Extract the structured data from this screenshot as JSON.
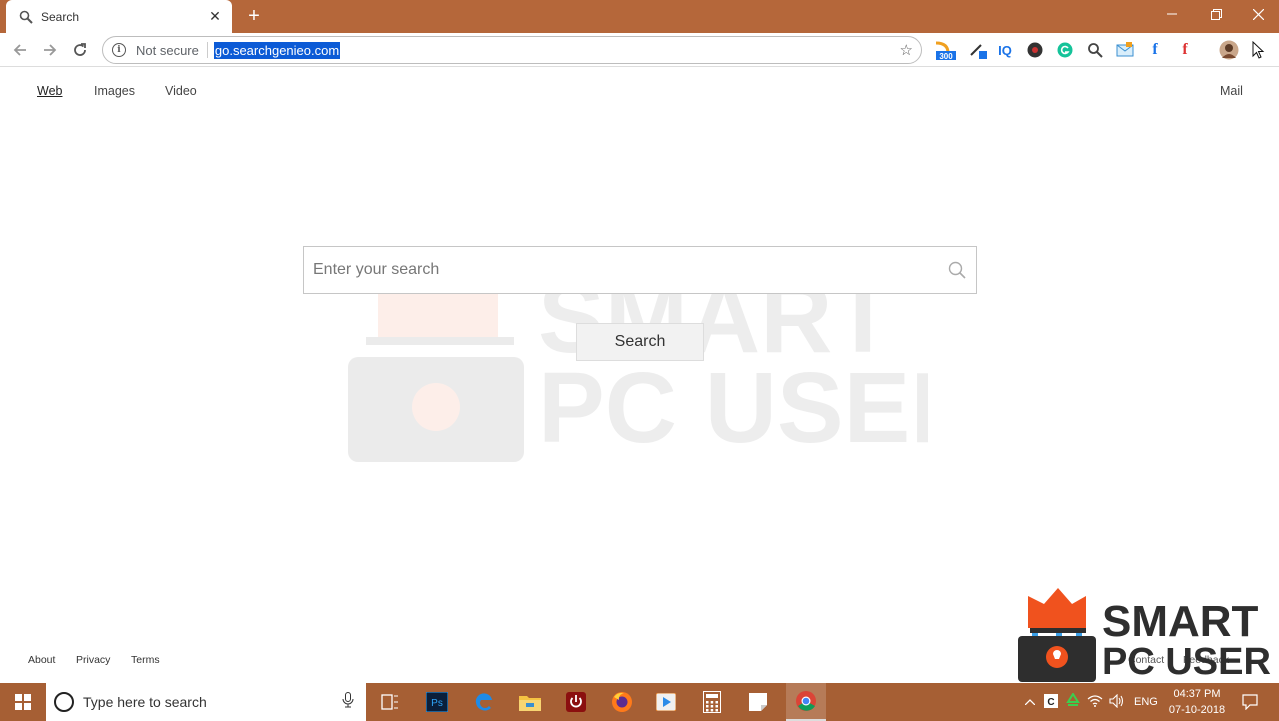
{
  "browser": {
    "tab_title": "Search",
    "address": {
      "security_label": "Not secure",
      "url": "go.searchgenieo.com"
    },
    "extension_badge": "300",
    "extension_iq": "IQ"
  },
  "page": {
    "nav": {
      "web": "Web",
      "images": "Images",
      "video": "Video",
      "mail": "Mail"
    },
    "search": {
      "placeholder": "Enter your search",
      "button_label": "Search"
    },
    "footer": {
      "about": "About",
      "privacy": "Privacy",
      "terms": "Terms",
      "contact": "Contact",
      "feedback": "Feedback"
    },
    "watermark": {
      "line1": "SMART",
      "line2": "PC USER"
    }
  },
  "taskbar": {
    "search_placeholder": "Type here to search",
    "language": "ENG",
    "time": "04:37 PM",
    "date": "07-10-2018"
  },
  "colors": {
    "titlebar": "#b5673a",
    "taskbar": "#a65f34",
    "url_highlight": "#0c5bd6",
    "logo_orange": "#f0521e",
    "logo_dark": "#2e2e2e"
  }
}
